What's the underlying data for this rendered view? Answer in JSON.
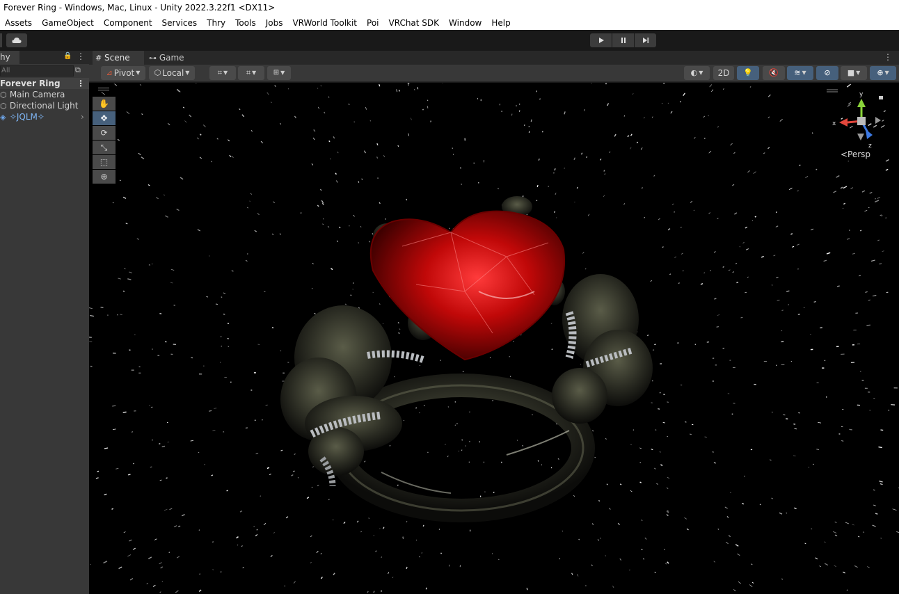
{
  "window": {
    "title": "Forever Ring - Windows, Mac, Linux - Unity 2022.3.22f1 <DX11>"
  },
  "menu": [
    "Assets",
    "GameObject",
    "Component",
    "Services",
    "Thry",
    "Tools",
    "Jobs",
    "VRWorld Toolkit",
    "Poi",
    "VRChat SDK",
    "Window",
    "Help"
  ],
  "toolbar": {
    "cloud_icon": "cloud-icon",
    "play_icon": "play-icon",
    "pause_icon": "pause-icon",
    "step_icon": "step-icon"
  },
  "hierarchy": {
    "tab_label": "hy",
    "search_placeholder": "All",
    "scene_name": "Forever Ring",
    "items": [
      {
        "label": "Main Camera",
        "icon": "gameobject-icon"
      },
      {
        "label": "Directional Light",
        "icon": "gameobject-icon"
      },
      {
        "label": "✧JQLM✧",
        "icon": "prefab-icon"
      }
    ]
  },
  "scene_view": {
    "tabs": [
      {
        "label": "Scene",
        "icon": "grid-icon"
      },
      {
        "label": "Game",
        "icon": "gamepad-icon"
      }
    ],
    "pivot_label": "Pivot",
    "local_label": "Local",
    "mode_2d_label": "2D",
    "gizmo": {
      "x_label": "x",
      "y_label": "y",
      "z_label": "z",
      "projection_label": "<Persp"
    },
    "colors": {
      "x_axis": "#e3473c",
      "y_axis": "#8ad43a",
      "z_axis": "#3c79e3",
      "active_button": "#46607c"
    }
  }
}
